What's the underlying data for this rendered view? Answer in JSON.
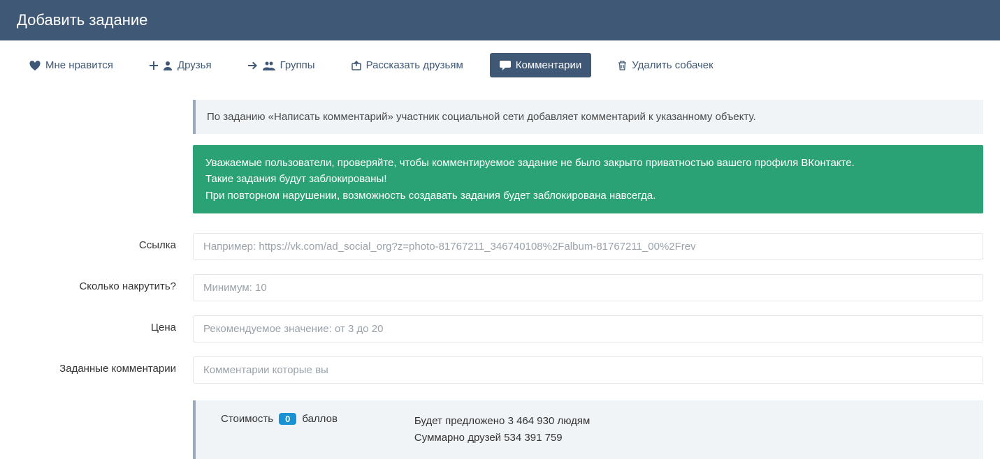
{
  "header": {
    "title": "Добавить задание"
  },
  "tabs": {
    "like": "Мне нравится",
    "friends": "Друзья",
    "groups": "Группы",
    "share": "Рассказать друзьям",
    "comments": "Комментарии",
    "delete_dogs": "Удалить собачек"
  },
  "info": {
    "description": "По заданию «Написать комментарий» участник социальной сети добавляет комментарий к указанному объекту."
  },
  "warning": {
    "line1": "Уважаемые пользователи, проверяйте, чтобы комментируемое задание не было закрыто приватностью вашего профиля ВКонтакте.",
    "line2": "Такие задания будут заблокированы!",
    "line3": "При повторном нарушении, возможность создавать задания будет заблокирована навсегда."
  },
  "form": {
    "link": {
      "label": "Ссылка",
      "placeholder": "Например: https://vk.com/ad_social_org?z=photo-81767211_346740108%2Falbum-81767211_00%2Frev"
    },
    "amount": {
      "label": "Сколько накрутить?",
      "placeholder": "Минимум: 10"
    },
    "price": {
      "label": "Цена",
      "placeholder": "Рекомендуемое значение: от 3 до 20"
    },
    "comments": {
      "label": "Заданные комментарии",
      "placeholder": "Комментарии которые вы"
    }
  },
  "summary": {
    "cost_prefix": "Стоимость",
    "cost_badge": "0",
    "cost_suffix": "баллов",
    "offered": "Будет предложено 3 464 930 людям",
    "friends_total": "Суммарно друзей 534 391 759"
  }
}
